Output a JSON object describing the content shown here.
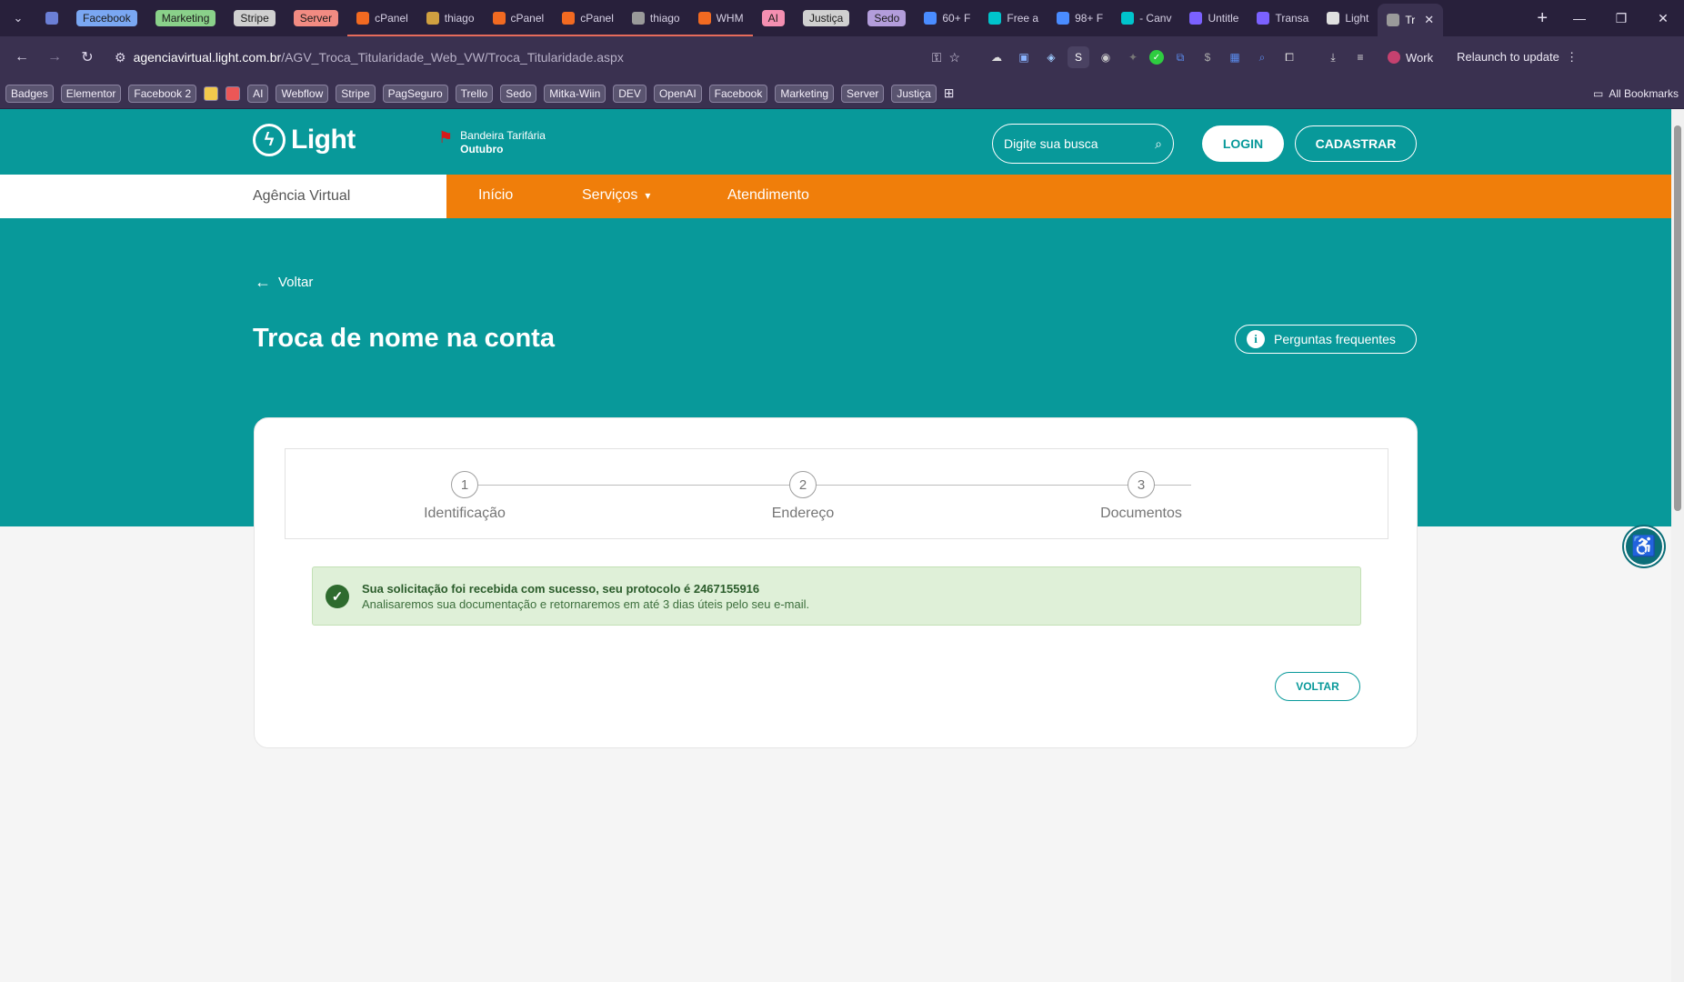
{
  "browser": {
    "tabs": [
      {
        "label": "",
        "kind": "icon",
        "color": "#6b7fd6"
      },
      {
        "label": "Facebook",
        "kind": "pill",
        "color": "#7aa7f2"
      },
      {
        "label": "Marketing",
        "kind": "pill",
        "color": "#8ad18a"
      },
      {
        "label": "Stripe",
        "kind": "pill",
        "color": "#d0d0d0"
      },
      {
        "label": "Server",
        "kind": "pill",
        "color": "#f28b82"
      },
      {
        "label": "cPanel",
        "kind": "site",
        "color": "#f26a21"
      },
      {
        "label": "thiago",
        "kind": "site",
        "color": "#d0a040"
      },
      {
        "label": "cPanel",
        "kind": "site",
        "color": "#f26a21"
      },
      {
        "label": "cPanel",
        "kind": "site",
        "color": "#f26a21"
      },
      {
        "label": "thiago",
        "kind": "site",
        "color": "#9a9a9a"
      },
      {
        "label": "WHM",
        "kind": "site",
        "color": "#f26a21"
      },
      {
        "label": "AI",
        "kind": "pill",
        "color": "#f48fb1"
      },
      {
        "label": "Justiça",
        "kind": "pill",
        "color": "#d0d0d0"
      },
      {
        "label": "Sedo",
        "kind": "pill",
        "color": "#b39ddb"
      },
      {
        "label": "60+ F",
        "kind": "site",
        "color": "#4a8cff"
      },
      {
        "label": "Free a",
        "kind": "site",
        "color": "#00c4cc"
      },
      {
        "label": "98+ F",
        "kind": "site",
        "color": "#4a8cff"
      },
      {
        "label": "- Canv",
        "kind": "site",
        "color": "#00c4cc"
      },
      {
        "label": "Untitle",
        "kind": "site",
        "color": "#7b61ff"
      },
      {
        "label": "Transa",
        "kind": "site",
        "color": "#7b61ff"
      },
      {
        "label": "Light",
        "kind": "site",
        "color": "#e0e0e0"
      },
      {
        "label": "Tr",
        "kind": "active",
        "color": "#9a9a9a"
      }
    ],
    "url_host": "agenciavirtual.light.com.br",
    "url_path": "/AGV_Troca_Titularidade_Web_VW/Troca_Titularidade.aspx",
    "profile_label": "Work",
    "relaunch_label": "Relaunch to update",
    "bookmarks": [
      {
        "label": "Badges",
        "color": "#5a5470"
      },
      {
        "label": "Elementor",
        "color": "#5a5470"
      },
      {
        "label": "Facebook 2",
        "color": "#5a5470"
      },
      {
        "label": "",
        "color": "#f2c94c"
      },
      {
        "label": "",
        "color": "#eb5757"
      },
      {
        "label": "AI",
        "color": "#5a5470"
      },
      {
        "label": "Webflow",
        "color": "#5a5470"
      },
      {
        "label": "Stripe",
        "color": "#5a5470"
      },
      {
        "label": "PagSeguro",
        "color": "#5a5470"
      },
      {
        "label": "Trello",
        "color": "#5a5470"
      },
      {
        "label": "Sedo",
        "color": "#5a5470"
      },
      {
        "label": "Mitka-Wiin",
        "color": "#5a5470"
      },
      {
        "label": "DEV",
        "color": "#5a5470"
      },
      {
        "label": "OpenAI",
        "color": "#5a5470"
      },
      {
        "label": "Facebook",
        "color": "#5a5470"
      },
      {
        "label": "Marketing",
        "color": "#5a5470"
      },
      {
        "label": "Server",
        "color": "#5a5470"
      },
      {
        "label": "Justiça",
        "color": "#5a5470"
      }
    ],
    "all_bookmarks_label": "All Bookmarks"
  },
  "header": {
    "brand": "Light",
    "tarifa_title": "Bandeira Tarifária",
    "tarifa_month": "Outubro",
    "search_placeholder": "Digite sua busca",
    "login_label": "LOGIN",
    "register_label": "CADASTRAR"
  },
  "nav": {
    "section": "Agência Virtual",
    "items": [
      "Início",
      "Serviços",
      "Atendimento"
    ]
  },
  "main": {
    "back_label": "Voltar",
    "title": "Troca de nome na conta",
    "faq_label": "Perguntas frequentes",
    "steps": [
      {
        "num": "1",
        "label": "Identificação"
      },
      {
        "num": "2",
        "label": "Endereço"
      },
      {
        "num": "3",
        "label": "Documentos"
      }
    ],
    "success_line1": "Sua solicitação foi recebida com sucesso, seu protocolo é 2467155916",
    "success_line2": "Analisaremos sua documentação e retornaremos em até 3 dias úteis pelo seu e-mail.",
    "voltar_button": "VOLTAR"
  },
  "colors": {
    "brand_teal": "#08999a",
    "nav_orange": "#f07e0a",
    "success_bg": "#dff0d8"
  }
}
